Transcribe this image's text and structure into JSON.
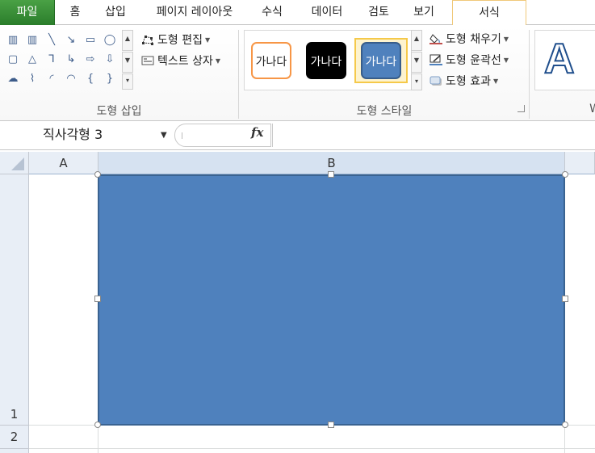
{
  "tabs": {
    "file": "파일",
    "home": "홈",
    "insert": "삽입",
    "page_layout": "페이지 레이아웃",
    "formulas": "수식",
    "data": "데이터",
    "review": "검토",
    "view": "보기",
    "format": "서식"
  },
  "ribbon": {
    "insert_shapes": {
      "label": "도형 삽입",
      "edit_shape": "도형 편집",
      "text_box": "텍스트 상자",
      "gallery": [
        "▥",
        "▥",
        "╲",
        "↘",
        "▭",
        "◯",
        "▢",
        "△",
        "⅂",
        "↳",
        "⇨",
        "⇩",
        "☁",
        "⌇",
        "◜",
        "◠",
        "{",
        "}"
      ]
    },
    "shape_styles": {
      "label": "도형 스타일",
      "samples": [
        {
          "text": "가나다",
          "fill": "#ffffff",
          "border": "#f79646",
          "color": "#222222"
        },
        {
          "text": "가나다",
          "fill": "#000000",
          "border": "#000000",
          "color": "#ffffff"
        },
        {
          "text": "가나다",
          "fill": "#4f81bd",
          "border": "#385d8a",
          "color": "#ffffff"
        }
      ],
      "fill": "도형 채우기",
      "outline": "도형 윤곽선",
      "effects": "도형 효과"
    },
    "wordart": {
      "letter": "A",
      "label": "W"
    }
  },
  "formula_bar": {
    "name_box": "직사각형 3",
    "fx": "fx",
    "formula": ""
  },
  "sheet": {
    "columns": [
      "A",
      "B"
    ],
    "rows": [
      "1",
      "2"
    ]
  },
  "colors": {
    "file_tab": "#2b7d2b",
    "shape_fill": "#4f81bd",
    "header_bg": "#e8eef6",
    "active_tab_border": "#f0c97a"
  }
}
